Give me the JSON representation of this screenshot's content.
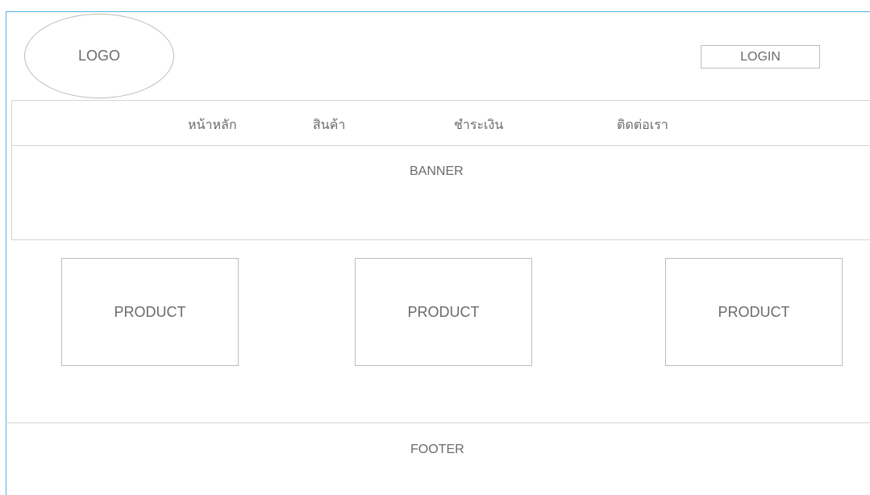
{
  "header": {
    "logo_label": "LOGO",
    "login_label": "LOGIN"
  },
  "nav": {
    "items": [
      {
        "label": "หน้าหลัก"
      },
      {
        "label": "สินค้า"
      },
      {
        "label": "ชำระเงิน"
      },
      {
        "label": "ติดต่อเรา"
      }
    ]
  },
  "banner": {
    "label": "BANNER"
  },
  "products": [
    {
      "label": "PRODUCT"
    },
    {
      "label": "PRODUCT"
    },
    {
      "label": "PRODUCT"
    }
  ],
  "footer": {
    "label": "FOOTER"
  }
}
